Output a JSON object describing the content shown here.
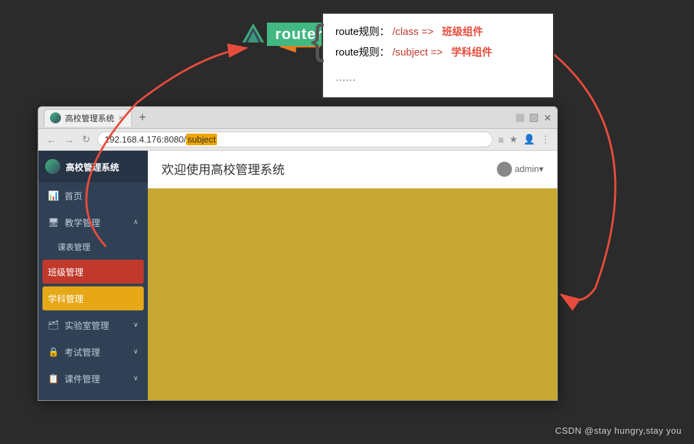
{
  "background": "#2b2b2b",
  "annotation": {
    "route1_prefix": "route规则：",
    "route1_path": "/class =>",
    "route1_component": "班级组件",
    "route2_prefix": "route规则：",
    "route2_path": "/subject =>",
    "route2_component": "学科组件",
    "dots": "......"
  },
  "vue_router": {
    "label": "router"
  },
  "browser": {
    "tab_title": "高校管理系统",
    "tab_close": "×",
    "new_tab": "+",
    "url_base": "192.168.4.176:8080/",
    "url_highlight": "subject",
    "win_controls": [
      "—",
      "□",
      "×"
    ],
    "nav_back": "←",
    "nav_forward": "→",
    "nav_reload": "↻"
  },
  "app": {
    "title": "高校管理系统",
    "header_title": "欢迎使用高校管理系统",
    "admin_label": "admin▾",
    "sidebar_items": [
      {
        "label": "首页",
        "icon": "📊",
        "type": "item"
      },
      {
        "label": "教学管理",
        "icon": "🖥",
        "type": "group",
        "chevron": "∧"
      },
      {
        "label": "课表管理",
        "icon": "",
        "type": "sub"
      },
      {
        "label": "班级管理",
        "icon": "",
        "type": "active-red"
      },
      {
        "label": "学科管理",
        "icon": "",
        "type": "active-gold"
      },
      {
        "label": "实验室管理",
        "icon": "🗂",
        "type": "group",
        "chevron": "∨"
      },
      {
        "label": "考试管理",
        "icon": "🔒",
        "type": "group",
        "chevron": "∨"
      },
      {
        "label": "课件管理",
        "icon": "📋",
        "type": "group",
        "chevron": "∨"
      }
    ]
  },
  "watermark": "CSDN @stay hungry,stay you"
}
